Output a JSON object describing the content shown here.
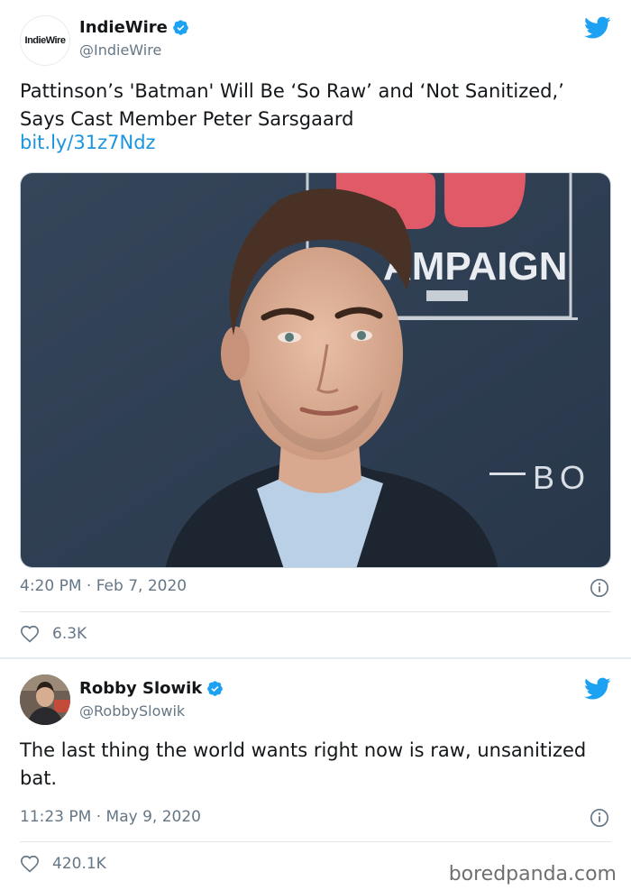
{
  "tweets": [
    {
      "avatar_text": "IndieWire",
      "name": "IndieWire",
      "handle": "@IndieWire",
      "verified": true,
      "text": "Pattinson’s 'Batman' Will Be ‘So Raw’ and ‘Not Sanitized,’ Says Cast Member Peter Sarsgaard",
      "link": "bit.ly/31z7Ndz",
      "photo": {
        "backdrop_text": "AMPAIGN",
        "backdrop_sub": "BO"
      },
      "timestamp": "4:20 PM · Feb 7, 2020",
      "likes": "6.3K"
    },
    {
      "name": "Robby Slowik",
      "handle": "@RobbySlowik",
      "verified": true,
      "text": "The last thing the world wants right now is raw, unsanitized bat.",
      "timestamp": "11:23 PM · May 9, 2020",
      "likes": "420.1K"
    }
  ],
  "watermark": "boredpanda.com",
  "colors": {
    "twitter_blue": "#1da1f2",
    "link": "#1b95e0",
    "muted": "#657786"
  },
  "icons": [
    "twitter-bird-icon",
    "verified-badge-icon",
    "info-icon",
    "heart-icon"
  ]
}
